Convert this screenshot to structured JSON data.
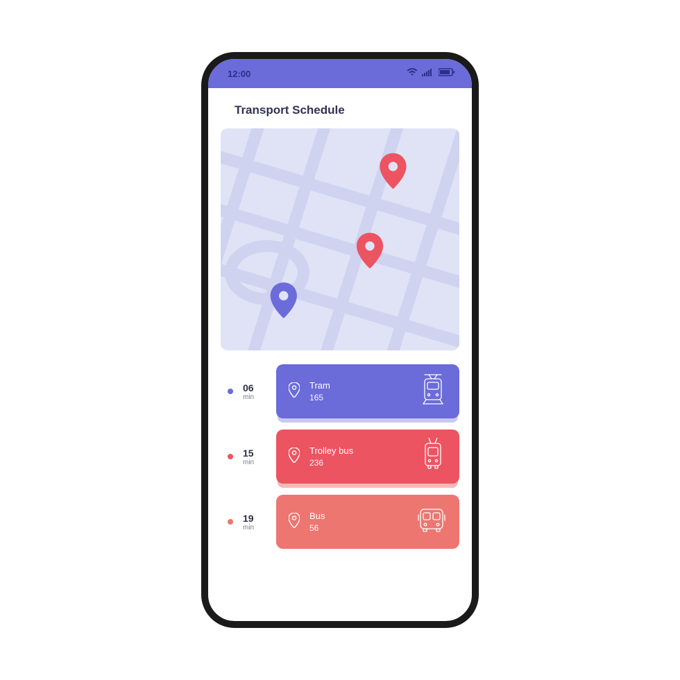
{
  "status": {
    "time": "12:00"
  },
  "page": {
    "title": "Transport Schedule"
  },
  "colors": {
    "violet": "#6b6bda",
    "red": "#ec5461",
    "salmon": "#ed7670",
    "violetDot": "#6b6bda",
    "redDot": "#ec5461",
    "salmonDot": "#ed7670"
  },
  "schedule": [
    {
      "time": "06",
      "unit": "min",
      "name": "Tram",
      "number": "165",
      "color": "violet",
      "vehicle": "tram"
    },
    {
      "time": "15",
      "unit": "min",
      "name": "Trolley bus",
      "number": "236",
      "color": "red",
      "vehicle": "trolleybus"
    },
    {
      "time": "19",
      "unit": "min",
      "name": "Bus",
      "number": "56",
      "color": "salmon",
      "vehicle": "bus"
    }
  ]
}
